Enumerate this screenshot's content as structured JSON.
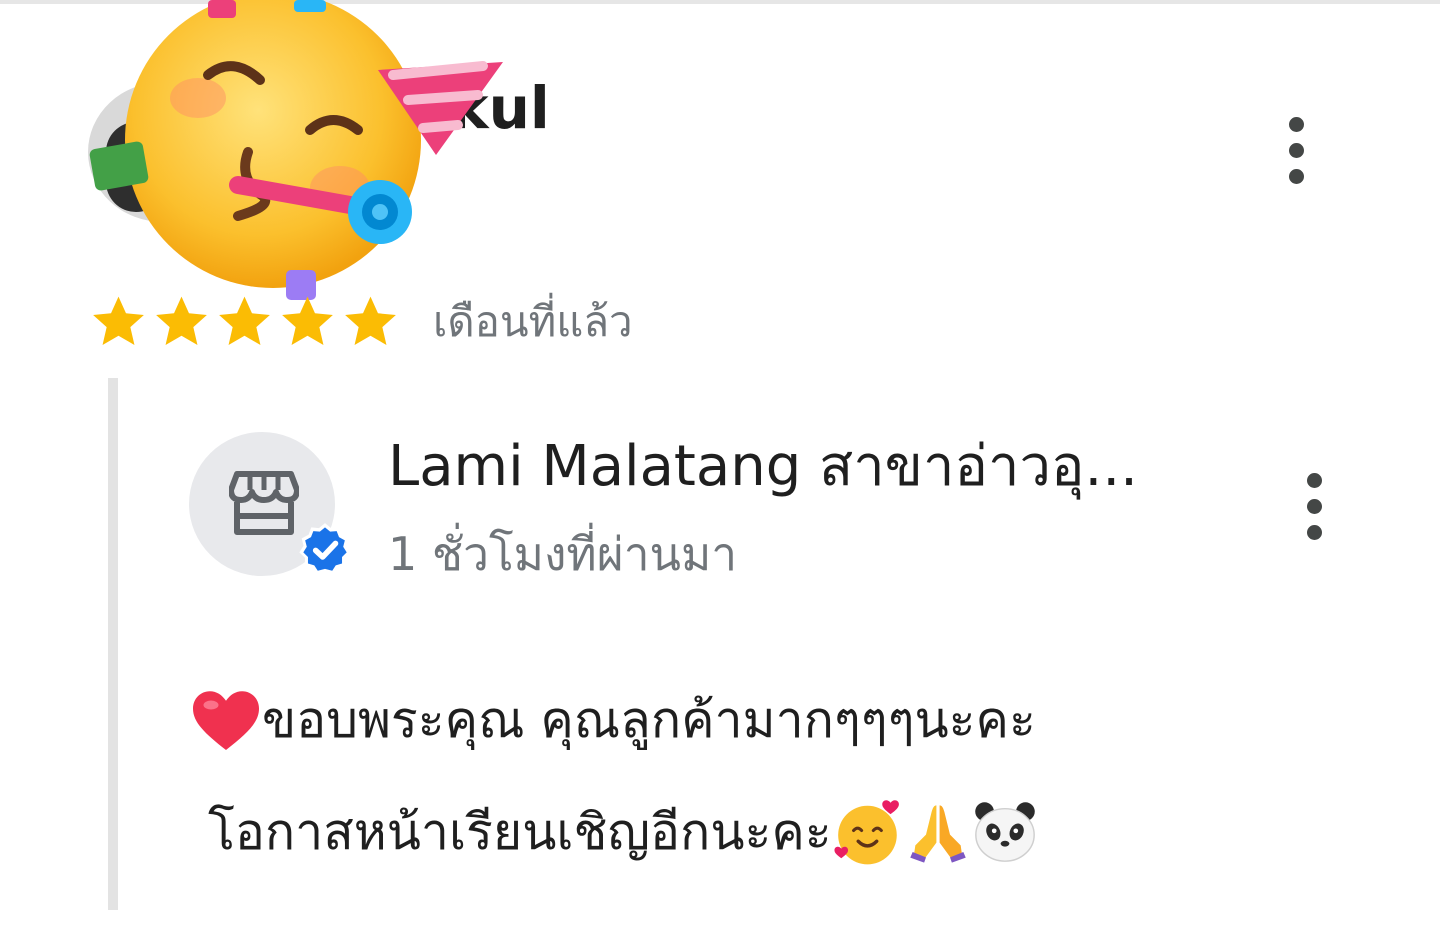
{
  "review": {
    "reviewer_name_visible": "kul",
    "rating": 5,
    "rating_max": 5,
    "date": "เดือนที่แล้ว"
  },
  "reply": {
    "owner_name": "Lami Malatang สาขาอ่าวอุ...",
    "time": "1 ชั่วโมงที่ผ่านมา",
    "line1_text": "ขอบพระคุณ คุณลูกค้ามากๆๆๆนะคะ",
    "line2_text": "โอกาสหน้าเรียนเชิญอีกนะคะ"
  },
  "icons": {
    "menu": "more-vert-icon",
    "store": "store-icon",
    "verified": "verified-badge-icon",
    "star": "star-icon",
    "emoji_party": "partying-face-emoji",
    "emoji_heart": "red-heart-emoji",
    "emoji_love": "smiling-face-with-hearts-emoji",
    "emoji_pray": "folded-hands-emoji",
    "emoji_panda": "panda-emoji"
  },
  "colors": {
    "star": "#fbbc04",
    "verified": "#1a73e8",
    "secondary_text": "#70757a",
    "primary_text": "#1f1f1f"
  }
}
